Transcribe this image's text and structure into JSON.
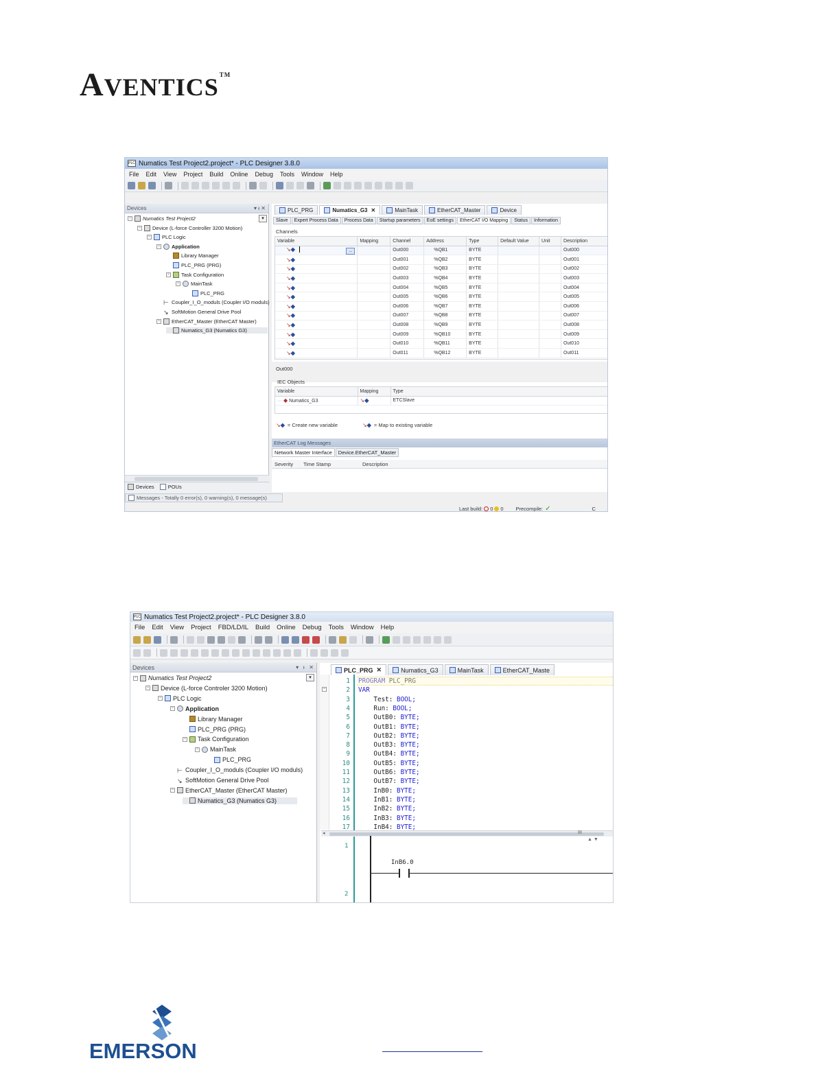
{
  "brand": {
    "aventics": "AVENTICS",
    "trademark": "TM",
    "emerson": "EMERSON"
  },
  "shot1": {
    "title": "Numatics Test Project2.project* - PLC Designer 3.8.0",
    "menu": [
      "File",
      "Edit",
      "View",
      "Project",
      "Build",
      "Online",
      "Debug",
      "Tools",
      "Window",
      "Help"
    ],
    "devices_panel": {
      "title": "Devices",
      "pin": "▾ ᵼ ✕"
    },
    "tree": [
      {
        "label": "Numatics Test Project2",
        "icon": "project-icon",
        "italic": true
      },
      {
        "label": "Device (L-force Controller 3200 Motion)",
        "icon": "device-icon"
      },
      {
        "label": "PLC Logic",
        "icon": "plc-icon"
      },
      {
        "label": "Application",
        "icon": "gear-icon",
        "bold": true
      },
      {
        "label": "Library Manager",
        "icon": "library-icon"
      },
      {
        "label": "PLC_PRG (PRG)",
        "icon": "program-icon"
      },
      {
        "label": "Task Configuration",
        "icon": "task-icon"
      },
      {
        "label": "MainTask",
        "icon": "gear-icon"
      },
      {
        "label": "PLC_PRG",
        "icon": "program-icon"
      },
      {
        "label": "Coupler_I_O_moduls (Coupler I/O moduls)",
        "icon": "coupler-icon"
      },
      {
        "label": "SoftMotion General Drive Pool",
        "icon": "drive-icon"
      },
      {
        "label": "EtherCAT_Master (EtherCAT Master)",
        "icon": "ethercat-icon"
      },
      {
        "label": "Numatics_G3 (Numatics G3)",
        "icon": "module-icon"
      }
    ],
    "editor_tabs": [
      "PLC_PRG",
      "Numatics_G3",
      "MainTask",
      "EtherCAT_Master",
      "Device"
    ],
    "active_tab": "Numatics_G3",
    "subtabs": [
      "Slave",
      "Expert Process Data",
      "Process Data",
      "Startup parameters",
      "EoE settings",
      "EtherCAT I/O Mapping",
      "Status",
      "Information"
    ],
    "active_subtab": "EtherCAT I/O Mapping",
    "channels_label": "Channels",
    "columns": [
      "Variable",
      "Mapping",
      "Channel",
      "Address",
      "Type",
      "Default Value",
      "Unit",
      "Description"
    ],
    "browse_button": "...",
    "rows": [
      {
        "channel": "Out000",
        "address": "%QB1",
        "type": "BYTE",
        "description": "Out000"
      },
      {
        "channel": "Out001",
        "address": "%QB2",
        "type": "BYTE",
        "description": "Out001"
      },
      {
        "channel": "Out002",
        "address": "%QB3",
        "type": "BYTE",
        "description": "Out002"
      },
      {
        "channel": "Out003",
        "address": "%QB4",
        "type": "BYTE",
        "description": "Out003"
      },
      {
        "channel": "Out004",
        "address": "%QB5",
        "type": "BYTE",
        "description": "Out004"
      },
      {
        "channel": "Out005",
        "address": "%QB6",
        "type": "BYTE",
        "description": "Out005"
      },
      {
        "channel": "Out006",
        "address": "%QB7",
        "type": "BYTE",
        "description": "Out006"
      },
      {
        "channel": "Out007",
        "address": "%QB8",
        "type": "BYTE",
        "description": "Out007"
      },
      {
        "channel": "Out008",
        "address": "%QB9",
        "type": "BYTE",
        "description": "Out008"
      },
      {
        "channel": "Out009",
        "address": "%QB10",
        "type": "BYTE",
        "description": "Out009"
      },
      {
        "channel": "Out010",
        "address": "%QB11",
        "type": "BYTE",
        "description": "Out010"
      },
      {
        "channel": "Out011",
        "address": "%QB12",
        "type": "BYTE",
        "description": "Out011"
      }
    ],
    "selected_channel": "Out000",
    "iec_objects_label": "IEC Objects",
    "iec_columns": [
      "Variable",
      "Mapping",
      "Type"
    ],
    "iec_row": {
      "variable": "Numatics_G3",
      "type": "ETCSlave"
    },
    "legend_create": "= Create new variable",
    "legend_map": "= Map to existing variable",
    "log_title": "EtherCAT Log Messages",
    "log_tabs": [
      "Network Master Interface",
      "Device.EtherCAT_Master"
    ],
    "log_columns": [
      "Severity",
      "Time Stamp",
      "Description"
    ],
    "bottom_tabs": [
      "Devices",
      "POUs"
    ],
    "messages": "Messages - Totally 0 error(s), 0 warning(s), 0 message(s)",
    "status": {
      "last_build": "Last build:",
      "errors": "0",
      "warnings": "0",
      "precompile": "Precompile:",
      "trailing": "C"
    }
  },
  "shot2": {
    "title": "Numatics Test Project2.project* - PLC Designer 3.8.0",
    "menu": [
      "File",
      "Edit",
      "View",
      "Project",
      "FBD/LD/IL",
      "Build",
      "Online",
      "Debug",
      "Tools",
      "Window",
      "Help"
    ],
    "devices_panel": {
      "title": "Devices"
    },
    "tree": [
      {
        "label": "Numatics Test Project2",
        "italic": true
      },
      {
        "label": "Device (L-force Controler 3200 Motion)"
      },
      {
        "label": "PLC Logic"
      },
      {
        "label": "Application",
        "bold": true
      },
      {
        "label": "Library Manager"
      },
      {
        "label": "PLC_PRG (PRG)"
      },
      {
        "label": "Task Configuration"
      },
      {
        "label": "MainTask"
      },
      {
        "label": "PLC_PRG"
      },
      {
        "label": "Coupler_I_O_moduls (Coupler I/O moduls)"
      },
      {
        "label": "SoftMotion General Drive Pool"
      },
      {
        "label": "EtherCAT_Master (EtherCAT Master)"
      },
      {
        "label": "Numatics_G3 (Numatics G3)"
      }
    ],
    "editor_tabs": [
      "PLC_PRG",
      "Numatics_G3",
      "MainTask",
      "EtherCAT_Maste"
    ],
    "code_lines": [
      {
        "n": "1",
        "kw": "PROGRAM",
        "rest": " PLC_PRG"
      },
      {
        "n": "2",
        "kw": "VAR",
        "rest": ""
      },
      {
        "n": "3",
        "kw": "",
        "rest": "    Test: ",
        "type": "BOOL;"
      },
      {
        "n": "4",
        "kw": "",
        "rest": "    Run: ",
        "type": "BOOL;"
      },
      {
        "n": "5",
        "kw": "",
        "rest": "    OutB0: ",
        "type": "BYTE;"
      },
      {
        "n": "6",
        "kw": "",
        "rest": "    OutB1: ",
        "type": "BYTE;"
      },
      {
        "n": "7",
        "kw": "",
        "rest": "    OutB2: ",
        "type": "BYTE;"
      },
      {
        "n": "8",
        "kw": "",
        "rest": "    OutB3: ",
        "type": "BYTE;"
      },
      {
        "n": "9",
        "kw": "",
        "rest": "    OutB4: ",
        "type": "BYTE;"
      },
      {
        "n": "10",
        "kw": "",
        "rest": "    OutB5: ",
        "type": "BYTE;"
      },
      {
        "n": "11",
        "kw": "",
        "rest": "    OutB6: ",
        "type": "BYTE;"
      },
      {
        "n": "12",
        "kw": "",
        "rest": "    OutB7: ",
        "type": "BYTE;"
      },
      {
        "n": "13",
        "kw": "",
        "rest": "    InB0: ",
        "type": "BYTE;"
      },
      {
        "n": "14",
        "kw": "",
        "rest": "    InB1: ",
        "type": "BYTE;"
      },
      {
        "n": "15",
        "kw": "",
        "rest": "    InB2: ",
        "type": "BYTE;"
      },
      {
        "n": "16",
        "kw": "",
        "rest": "    InB3: ",
        "type": "BYTE;"
      },
      {
        "n": "17",
        "kw": "",
        "rest": "    InB4: ",
        "type": "BYTE;"
      }
    ],
    "ladder_rungs": [
      "1",
      "2"
    ],
    "contact_label": "InB6.0",
    "scroll_mark": "III"
  }
}
